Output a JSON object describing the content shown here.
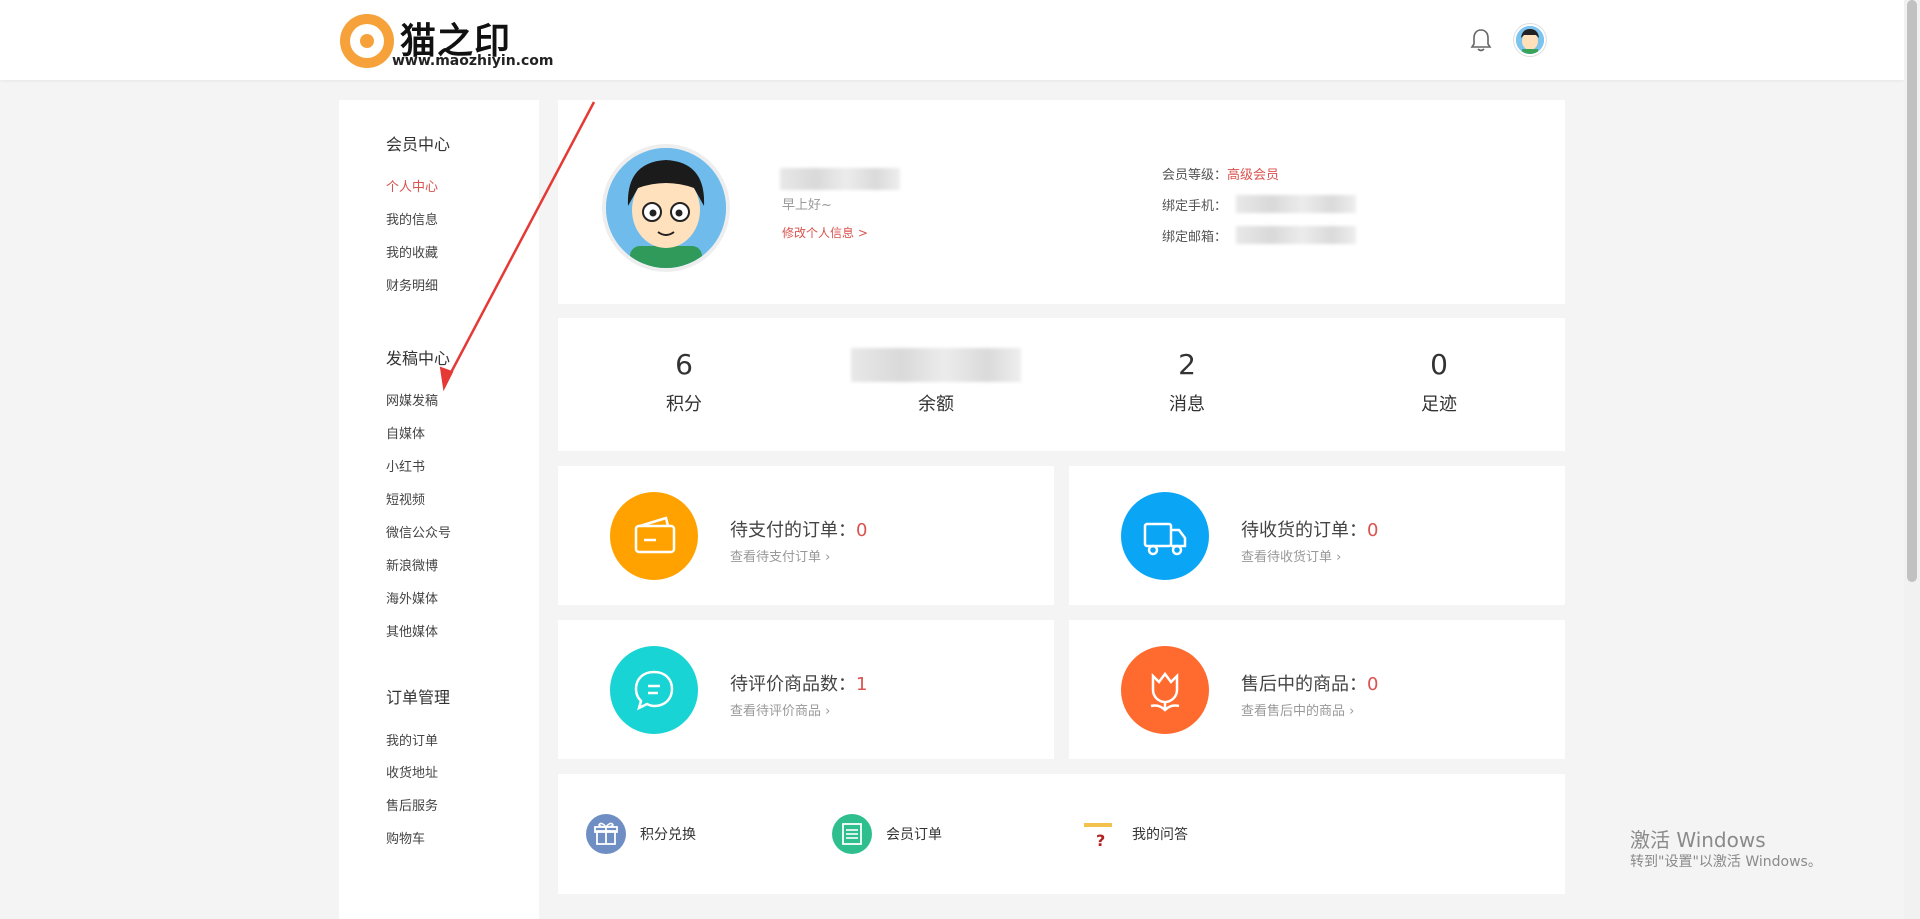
{
  "header": {
    "logo_title": "猫之印",
    "logo_url": "www.maozhiyin.com",
    "bell_icon": "bell-icon",
    "avatar_icon": "avatar-icon"
  },
  "sidebar": {
    "sections": [
      {
        "title": "会员中心",
        "items": [
          "个人中心",
          "我的信息",
          "我的收藏",
          "财务明细"
        ]
      },
      {
        "title": "发稿中心",
        "items": [
          "网媒发稿",
          "自媒体",
          "小红书",
          "短视频",
          "微信公众号",
          "新浪微博",
          "海外媒体",
          "其他媒体"
        ]
      },
      {
        "title": "订单管理",
        "items": [
          "我的订单",
          "收货地址",
          "售后服务",
          "购物车"
        ]
      }
    ],
    "active_item": "个人中心"
  },
  "profile": {
    "greeting": "早上好~",
    "edit_link": "修改个人信息 >",
    "level_label": "会员等级：",
    "level_value": "高级会员",
    "phone_label": "绑定手机：",
    "email_label": "绑定邮箱："
  },
  "stats": [
    {
      "value": "6",
      "label": "积分"
    },
    {
      "value": "",
      "label": "余额"
    },
    {
      "value": "2",
      "label": "消息"
    },
    {
      "value": "0",
      "label": "足迹"
    }
  ],
  "orders": [
    {
      "title": "待支付的订单：",
      "count": "0",
      "link": "查看待支付订单",
      "color": "#ffa200",
      "icon": "wallet-icon"
    },
    {
      "title": "待收货的订单：",
      "count": "0",
      "link": "查看待收货订单",
      "color": "#0aa6f5",
      "icon": "truck-icon"
    },
    {
      "title": "待评价商品数：",
      "count": "1",
      "link": "查看待评价商品",
      "color": "#18d4d4",
      "icon": "chat-bubble-icon"
    },
    {
      "title": "售后中的商品：",
      "count": "0",
      "link": "查看售后中的商品",
      "color": "#ff6a2e",
      "icon": "tulip-icon"
    }
  ],
  "quick_links": [
    {
      "label": "积分兑换",
      "icon": "gift-icon"
    },
    {
      "label": "会员订单",
      "icon": "list-icon"
    },
    {
      "label": "我的问答",
      "icon": "question-icon"
    }
  ],
  "watermark": {
    "line1": "激活 Windows",
    "line2": "转到\"设置\"以激活 Windows。"
  },
  "colors": {
    "accent_red": "#d9534f",
    "logo_orange": "#f6a13a"
  }
}
